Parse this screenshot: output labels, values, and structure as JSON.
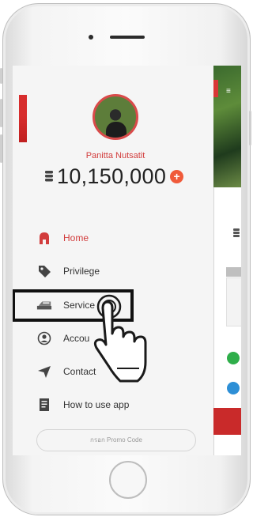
{
  "user": {
    "name": "Panitta Nutsatit",
    "points": "10,150,000",
    "add_symbol": "+"
  },
  "menu": {
    "items": [
      {
        "label": "Home",
        "icon": "home-icon",
        "active": true
      },
      {
        "label": "Privilege",
        "icon": "tag-icon",
        "active": false
      },
      {
        "label": "Service",
        "icon": "service-icon",
        "active": false
      },
      {
        "label": "Accou",
        "icon": "account-icon",
        "active": false
      },
      {
        "label": "Contact",
        "icon": "paper-plane-icon",
        "active": false
      },
      {
        "label": "How to use app",
        "icon": "document-icon",
        "active": false
      }
    ]
  },
  "promo": {
    "placeholder": "กรอก Promo Code"
  },
  "colors": {
    "accent": "#d23c3c",
    "plus": "#f05a3a",
    "highlight": "#111111"
  }
}
